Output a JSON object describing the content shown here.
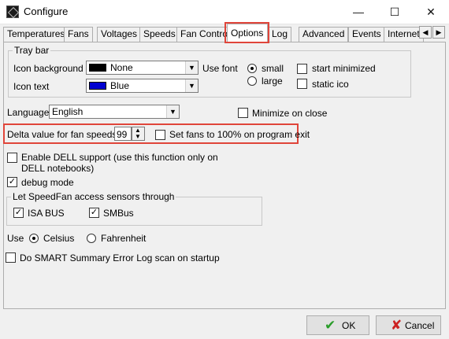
{
  "window": {
    "title": "Configure",
    "controls": {
      "minimize": "—",
      "maximize": "☐",
      "close": "✕"
    }
  },
  "tabs": [
    {
      "label": "Temperatures"
    },
    {
      "label": "Fans"
    },
    {
      "label": "Voltages"
    },
    {
      "label": "Speeds"
    },
    {
      "label": "Fan Control"
    },
    {
      "label": "Options",
      "active": true
    },
    {
      "label": "Log"
    },
    {
      "label": "Advanced"
    },
    {
      "label": "Events"
    },
    {
      "label": "Internet"
    }
  ],
  "tab_scroll": {
    "left": "◀",
    "right": "▶"
  },
  "tray_bar": {
    "legend": "Tray bar",
    "icon_background_label": "Icon background",
    "icon_background_value": "None",
    "icon_background_color": "#000000",
    "icon_text_label": "Icon text",
    "icon_text_value": "Blue",
    "icon_text_color": "#0000d0",
    "use_font_label": "Use font",
    "font_small_label": "small",
    "font_large_label": "large",
    "font_selected": "small",
    "start_minimized_label": "start minimized",
    "start_minimized_checked": false,
    "static_icon_label": "static ico",
    "static_icon_checked": false
  },
  "language": {
    "label": "Language",
    "value": "English"
  },
  "minimize_on_close": {
    "label": "Minimize on close",
    "checked": false
  },
  "delta": {
    "label": "Delta value for fan speeds",
    "value": "99"
  },
  "set_fans_100": {
    "label": "Set fans to 100% on program exit",
    "checked": false
  },
  "dell": {
    "label_line1": "Enable DELL support (use this function only on",
    "label_line2": "DELL notebooks)",
    "checked": false
  },
  "debug": {
    "label": "debug mode",
    "checked": true
  },
  "sensors": {
    "legend": "Let SpeedFan access sensors through",
    "isa_label": "ISA BUS",
    "isa_checked": true,
    "smbus_label": "SMBus",
    "smbus_checked": true
  },
  "units": {
    "use_label": "Use",
    "celsius_label": "Celsius",
    "fahrenheit_label": "Fahrenheit",
    "selected": "Celsius"
  },
  "smart": {
    "label": "Do SMART Summary Error Log scan on startup",
    "checked": false
  },
  "buttons": {
    "ok_label": "OK",
    "cancel_label": "Cancel",
    "ok_icon": "✔",
    "cancel_icon": "✘"
  },
  "colors": {
    "highlight": "#e0453a",
    "ok_check": "#2a9d2a",
    "cancel_x": "#cc2222"
  },
  "glyphs": {
    "checkmark": "✓",
    "dropdown": "▼",
    "spin_up": "▲",
    "spin_down": "▼"
  }
}
